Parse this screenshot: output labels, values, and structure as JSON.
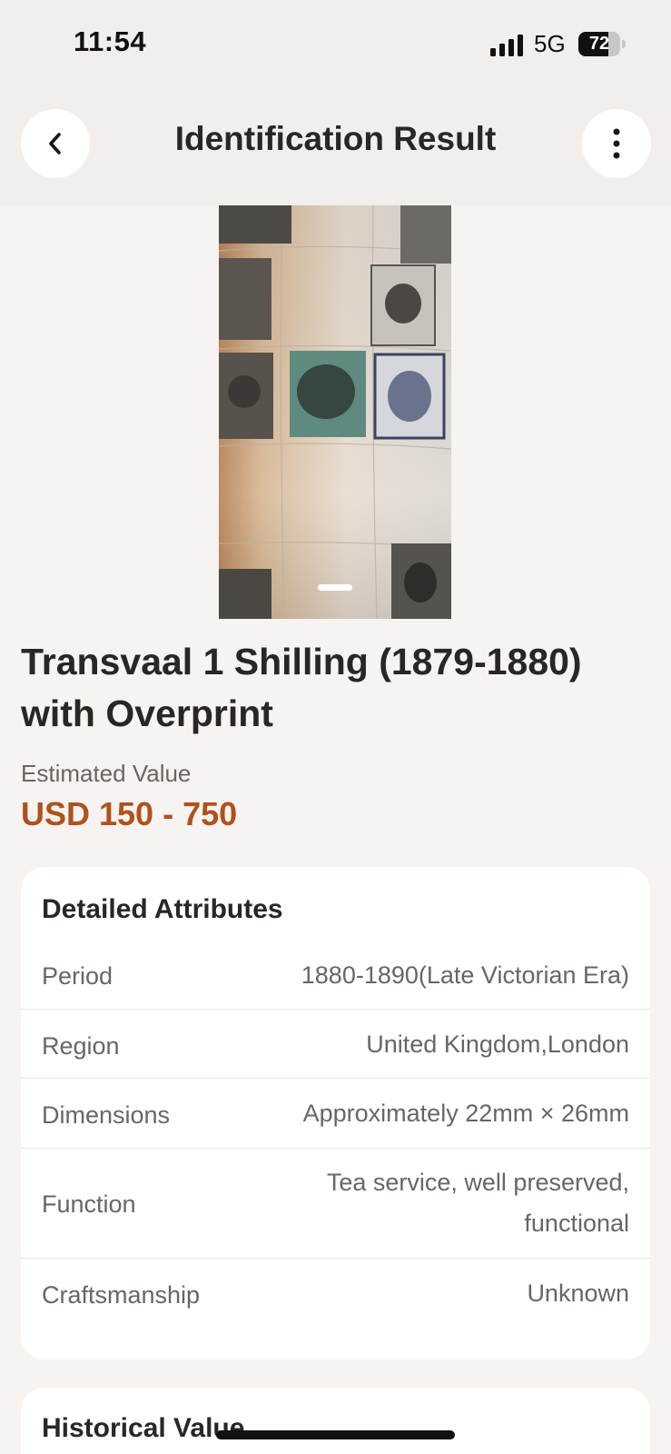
{
  "status_bar": {
    "time": "11:54",
    "network": "5G",
    "battery": "72",
    "battery_level": 0.72
  },
  "nav": {
    "title": "Identification Result",
    "back_icon": "chevron-left-icon",
    "more_icon": "more-vertical-icon"
  },
  "item": {
    "title": "Transvaal 1 Shilling (1879-1880) with Overprint",
    "value_label": "Estimated Value",
    "value": "USD 150 - 750"
  },
  "attributes": {
    "heading": "Detailed Attributes",
    "rows": [
      {
        "label": "Period",
        "value": "1880-1890(Late Victorian Era)"
      },
      {
        "label": "Region",
        "value": "United Kingdom,London"
      },
      {
        "label": "Dimensions",
        "value": "Approximately 22mm × 26mm"
      },
      {
        "label": "Function",
        "value": "Tea service, well preserved, functional"
      },
      {
        "label": "Craftsmanship",
        "value": "Unknown"
      }
    ]
  },
  "historical": {
    "heading": "Historical Value"
  },
  "colors": {
    "accent": "#b0511c",
    "background": "#f6f3f0",
    "card": "#ffffff"
  }
}
